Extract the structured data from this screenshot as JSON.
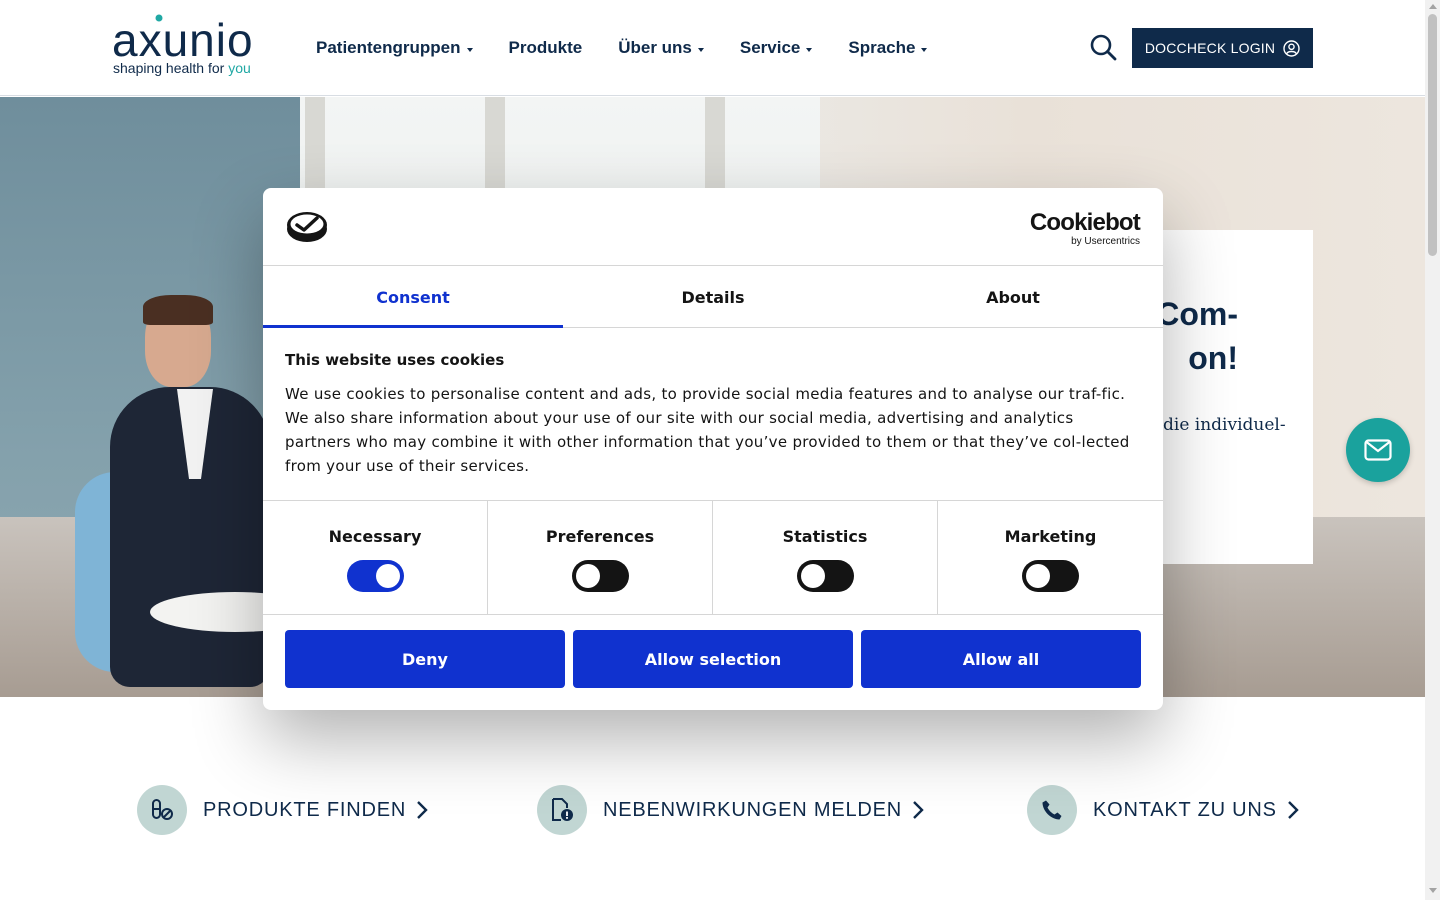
{
  "header": {
    "logo": {
      "word": "axunio",
      "tagline_prefix": "shaping health for ",
      "tagline_accent": "you"
    },
    "nav": [
      {
        "label": "Patientengruppen",
        "has_dropdown": true
      },
      {
        "label": "Produkte",
        "has_dropdown": false
      },
      {
        "label": "Über uns",
        "has_dropdown": true
      },
      {
        "label": "Service",
        "has_dropdown": true
      },
      {
        "label": "Sprache",
        "has_dropdown": true
      }
    ],
    "search_icon": "search-icon",
    "doccheck_label": "DOCCHECK LOGIN",
    "doccheck_icon": "user-circle-icon"
  },
  "hero": {
    "title_line1": "Com-",
    "title_line2": "on!",
    "text": "die individuel-"
  },
  "floating": {
    "icon": "mail-icon"
  },
  "quick_links": [
    {
      "label": "PRODUKTE FINDEN",
      "icon": "pills-icon"
    },
    {
      "label": "NEBENWIRKUNGEN MELDEN",
      "icon": "document-alert-icon"
    },
    {
      "label": "KONTAKT ZU UNS",
      "icon": "phone-icon"
    }
  ],
  "cookie_dialog": {
    "brand": "Cookiebot",
    "brand_sub": "by Usercentrics",
    "tabs": [
      {
        "label": "Consent",
        "active": true
      },
      {
        "label": "Details",
        "active": false
      },
      {
        "label": "About",
        "active": false
      }
    ],
    "heading": "This website uses cookies",
    "body": "We use cookies to personalise content and ads, to provide social media features and to analyse our traf-fic. We also share information about your use of our site with our social media, advertising and analytics partners who may combine it with other information that you’ve provided to them or that they’ve col-lected from your use of their services.",
    "categories": [
      {
        "label": "Necessary",
        "enabled": true
      },
      {
        "label": "Preferences",
        "enabled": false
      },
      {
        "label": "Statistics",
        "enabled": false
      },
      {
        "label": "Marketing",
        "enabled": false
      }
    ],
    "buttons": {
      "deny": "Deny",
      "allow_selection": "Allow selection",
      "allow_all": "Allow all"
    }
  },
  "colors": {
    "navy": "#0f2a4a",
    "teal": "#1aa29d",
    "cookiebot_blue": "#1032cf"
  }
}
